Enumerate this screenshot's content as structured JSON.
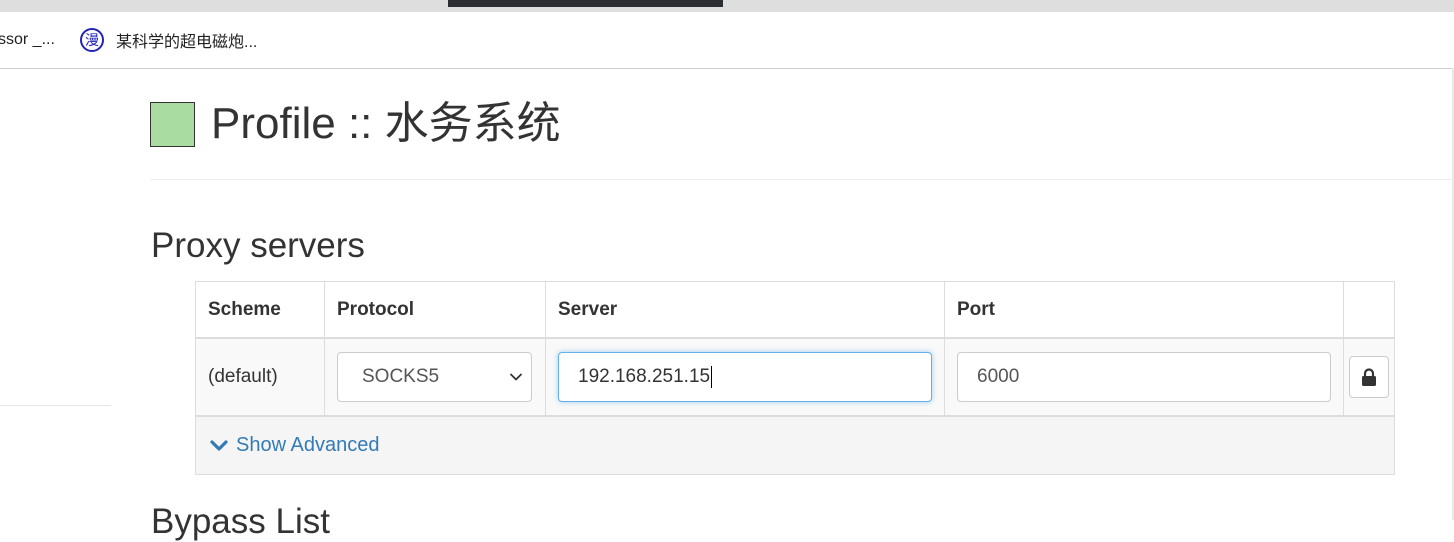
{
  "bookmarks": [
    {
      "label": "ssor _..."
    },
    {
      "icon_glyph": "漫",
      "label": "某科学的超电磁炮..."
    }
  ],
  "header": {
    "title": "Profile :: 水务系统",
    "profile_color": "#a9dca1"
  },
  "proxy_section": {
    "title": "Proxy servers",
    "columns": [
      "Scheme",
      "Protocol",
      "Server",
      "Port",
      ""
    ],
    "row": {
      "scheme": "(default)",
      "protocol": "SOCKS5",
      "server": "192.168.251.15",
      "port": "6000",
      "lock_icon": "lock-icon"
    },
    "show_advanced_label": "Show Advanced"
  },
  "bypass_section": {
    "title": "Bypass List"
  },
  "colors": {
    "link": "#337ab7",
    "focus_border": "#66afe9"
  }
}
